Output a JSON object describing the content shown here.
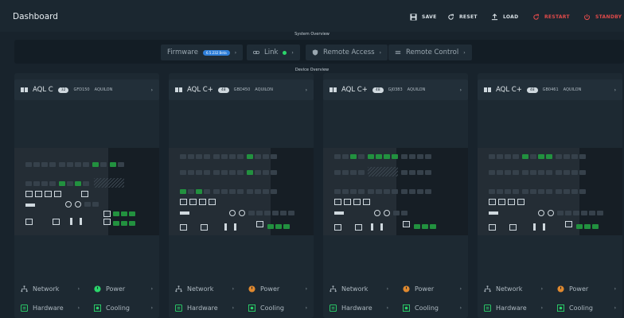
{
  "app": {
    "title": "Dashboard"
  },
  "toolbar": {
    "save": "SAVE",
    "reset": "RESET",
    "load": "LOAD",
    "restart": "RESTART",
    "standby": "STANDBY"
  },
  "system_overview": {
    "title": "System Overview",
    "firmware_label": "Firmware",
    "firmware_badge": "6.5.232 Beta",
    "link_label": "Link",
    "remote_access_label": "Remote Access",
    "remote_control_label": "Remote Control"
  },
  "device_overview": {
    "title": "Device Overview"
  },
  "devices": [
    {
      "name": "AQL C",
      "pill": "32",
      "model": "GFD150",
      "vendor": "AQUILON",
      "network": "Network",
      "power": "Power",
      "hardware": "Hardware",
      "cooling": "Cooling"
    },
    {
      "name": "AQL C+",
      "pill": "48",
      "model": "GBD450",
      "vendor": "AQUILON",
      "network": "Network",
      "power": "Power",
      "hardware": "Hardware",
      "cooling": "Cooling"
    },
    {
      "name": "AQL C+",
      "pill": "48",
      "model": "GJ0383",
      "vendor": "AQUILON",
      "network": "Network",
      "power": "Power",
      "hardware": "Hardware",
      "cooling": "Cooling"
    },
    {
      "name": "AQL C+",
      "pill": "48",
      "model": "GB0461",
      "vendor": "AQUILON",
      "network": "Network",
      "power": "Power",
      "hardware": "Hardware",
      "cooling": "Cooling"
    }
  ],
  "colors": {
    "accent": "#2f7fd9",
    "status_ok": "#2bd66b",
    "danger": "#e04a4a",
    "warning": "#e0892f"
  }
}
